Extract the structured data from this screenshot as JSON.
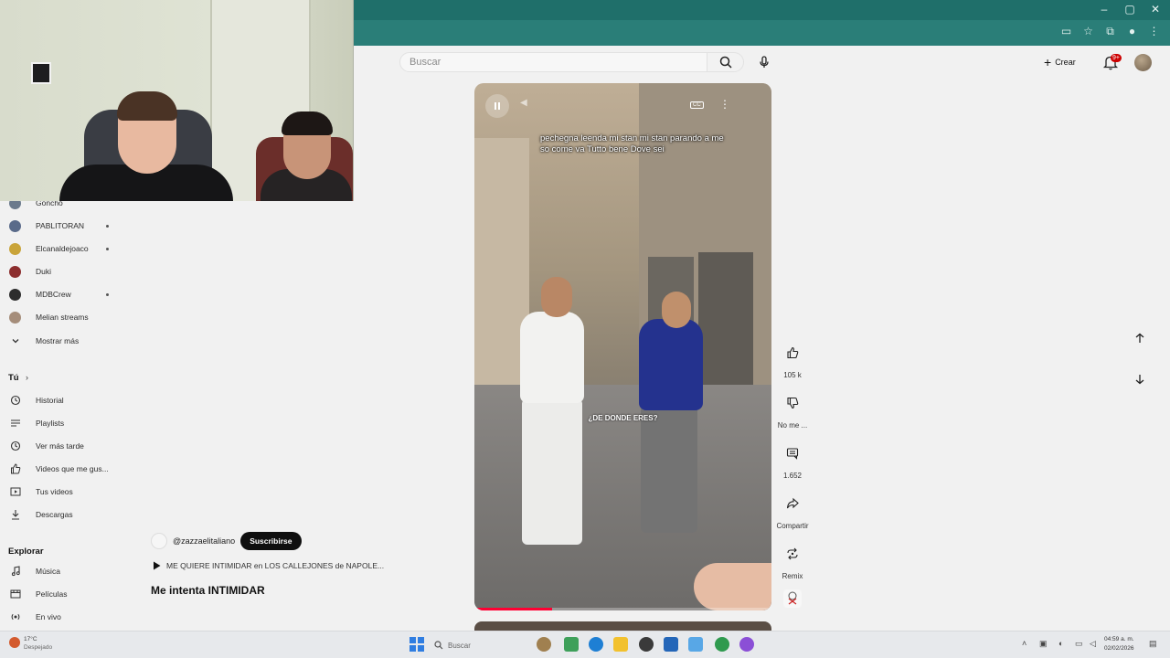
{
  "browser": {
    "window_controls": [
      "–",
      "▢",
      "✕"
    ]
  },
  "header": {
    "search_placeholder": "Buscar",
    "create_label": "Crear",
    "notifications_badge": "9+"
  },
  "sidebar": {
    "subscriptions": [
      {
        "label": "Goncho",
        "dot": false,
        "color": "#6b7a8c"
      },
      {
        "label": "PABLITORAN",
        "dot": true,
        "color": "#5a6b8a"
      },
      {
        "label": "Elcanaldejoaco",
        "dot": true,
        "color": "#c9a43a"
      },
      {
        "label": "Duki",
        "dot": false,
        "color": "#8c2e2e"
      },
      {
        "label": "MDBCrew",
        "dot": true,
        "color": "#2d2d2d"
      },
      {
        "label": "Melian streams",
        "dot": false,
        "color": "#a58d7a"
      }
    ],
    "show_more": "Mostrar más",
    "you_title": "Tú",
    "you_items": [
      {
        "label": "Historial",
        "icon": "history-icon"
      },
      {
        "label": "Playlists",
        "icon": "playlists-icon"
      },
      {
        "label": "Ver más tarde",
        "icon": "clock-icon"
      },
      {
        "label": "Videos que me gus...",
        "icon": "like-icon"
      },
      {
        "label": "Tus videos",
        "icon": "your-videos-icon"
      },
      {
        "label": "Descargas",
        "icon": "download-icon"
      }
    ],
    "explore_title": "Explorar",
    "explore_items": [
      {
        "label": "Música",
        "icon": "music-icon"
      },
      {
        "label": "Películas",
        "icon": "movies-icon"
      },
      {
        "label": "En vivo",
        "icon": "live-icon"
      }
    ]
  },
  "short": {
    "caption": "pechegna leenda mi stan mi stan parando a me so come va Tutto bene Dove sei",
    "subtitle": "¿DE DONDE ERES?",
    "cc_label": "CC",
    "progress_fraction": 0.26,
    "channel_handle": "@zazzaelitaliano",
    "subscribe_label": "Suscribirse",
    "audio_line": "ME QUIERE INTIMIDAR en LOS CALLEJONES de NAPOLE...",
    "title": "Me intenta INTIMIDAR"
  },
  "actions": {
    "likes": "105 k",
    "dislike_label": "No me ...",
    "comments": "1.652",
    "share_label": "Compartir",
    "remix_label": "Remix"
  },
  "taskbar": {
    "weather_temp": "17°C",
    "weather_cond": "Despejado",
    "search_label": "Buscar",
    "time": "04:59 a. m.",
    "date": "02/02/2026"
  }
}
